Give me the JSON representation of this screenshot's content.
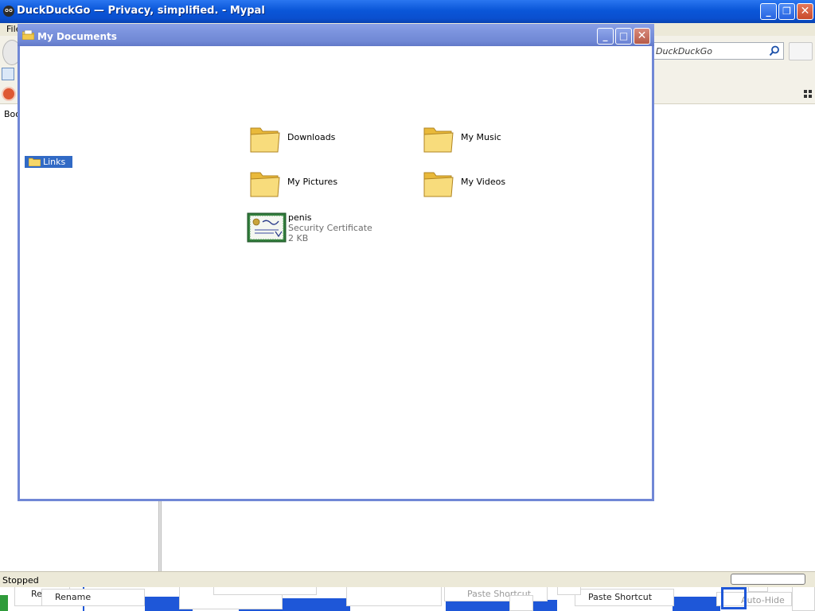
{
  "browser": {
    "title": "DuckDuckGo — Privacy, simplified. - Mypal",
    "menu": {
      "file": "File"
    },
    "bookmarks_label": "Boo",
    "search": {
      "placeholder": "DuckDuckGo"
    },
    "status": "Stopped"
  },
  "window": {
    "title": "My Documents",
    "controls": {
      "minimize": "_",
      "maximize": "□",
      "close": "✕"
    }
  },
  "sidebar": {
    "links_label": "Links"
  },
  "items": [
    {
      "name": "Downloads",
      "type": "folder"
    },
    {
      "name": "My Music",
      "type": "folder"
    },
    {
      "name": "My Pictures",
      "type": "folder"
    },
    {
      "name": "My Videos",
      "type": "folder"
    }
  ],
  "certificate": {
    "name": "penis",
    "type": "Security Certificate",
    "size": "2 KB"
  },
  "taskbar_ghosts": {
    "re": "Re",
    "rename": "Rename",
    "paste_shortcut_faded": "Paste Shortcut",
    "paste_shortcut": "Paste Shortcut",
    "auto_hide": "Auto-Hide"
  },
  "colors": {
    "xp_title_blue": "#0a56d8",
    "inactive_title": "#7a92dd",
    "selection": "#316ac5",
    "folder_yellow": "#f6d66a"
  }
}
